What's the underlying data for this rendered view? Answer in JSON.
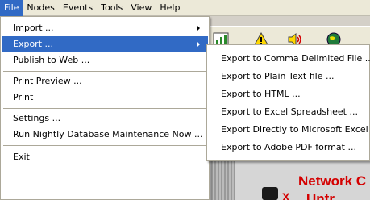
{
  "menubar": {
    "items": [
      "File",
      "Nodes",
      "Events",
      "Tools",
      "View",
      "Help"
    ]
  },
  "file_menu": {
    "import": "Import ...",
    "export": "Export ...",
    "publish": "Publish to Web ...",
    "print_preview": "Print Preview ...",
    "print": "Print",
    "settings": "Settings ...",
    "maintenance": "Run Nightly Database Maintenance Now ...",
    "exit": "Exit"
  },
  "export_submenu": {
    "items": [
      "Export to Comma Delimited File ...",
      "Export to Plain Text file ...",
      "Export to HTML ...",
      "Export to Excel Spreadsheet ...",
      "Export Directly to Microsoft Excel ...",
      "Export to Adobe PDF format ..."
    ]
  },
  "background": {
    "banner_title": "Network C",
    "banner_sub": "Untr",
    "banner_mark": "X"
  },
  "colors": {
    "highlight": "#316ac5",
    "menubar": "#ece9d8",
    "banner_text": "#d40000"
  }
}
